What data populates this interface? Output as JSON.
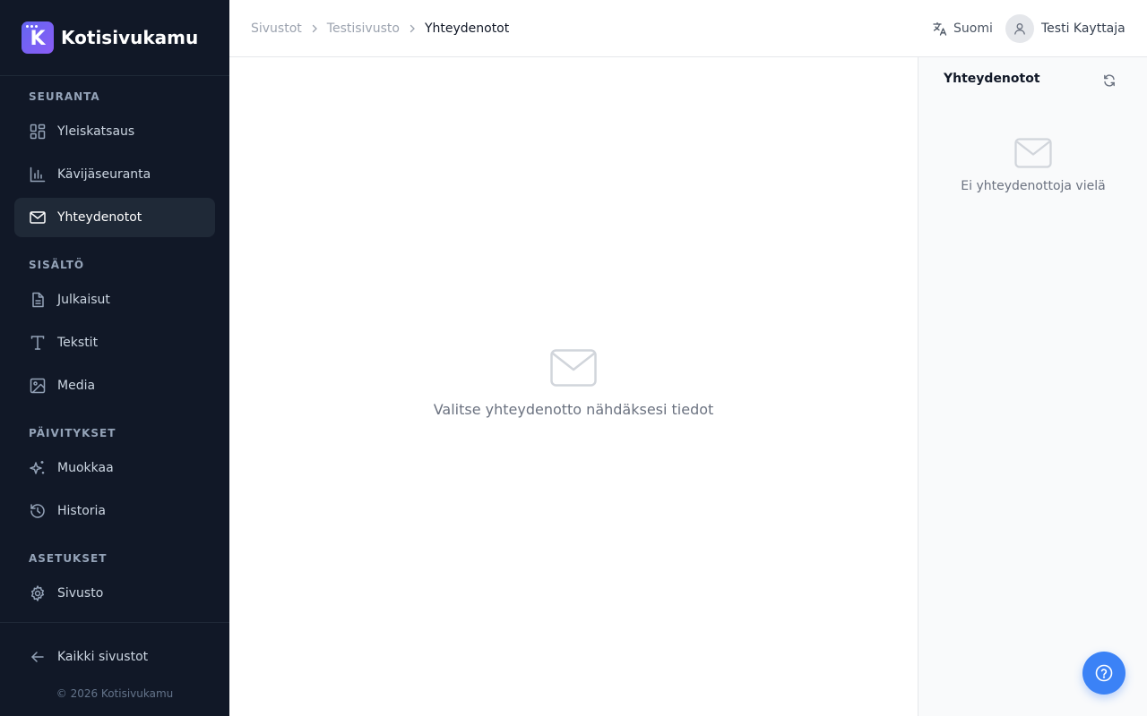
{
  "brand": {
    "name": "Kotisivukamu",
    "logo_letter": "K",
    "accent": "#6366f1"
  },
  "sidebar": {
    "sections": [
      {
        "title": "SEURANTA"
      },
      {
        "title": "SISÄLTÖ"
      },
      {
        "title": "PÄIVITYKSET"
      },
      {
        "title": "ASETUKSET"
      }
    ],
    "items": [
      {
        "label": "Yleiskatsaus",
        "icon": "grid-icon"
      },
      {
        "label": "Kävijäseuranta",
        "icon": "bar-chart-icon"
      },
      {
        "label": "Yhteydenotot",
        "icon": "mail-icon",
        "active": true
      },
      {
        "label": "Julkaisut",
        "icon": "document-icon"
      },
      {
        "label": "Tekstit",
        "icon": "text-icon"
      },
      {
        "label": "Media",
        "icon": "image-icon"
      },
      {
        "label": "Muokkaa",
        "icon": "sparkles-icon"
      },
      {
        "label": "Historia",
        "icon": "history-icon"
      },
      {
        "label": "Sivusto",
        "icon": "gear-icon"
      }
    ],
    "back_label": "Kaikki sivustot",
    "copyright": "© 2026 Kotisivukamu",
    "background": "#111827"
  },
  "header": {
    "breadcrumb": [
      "Sivustot",
      "Testisivusto",
      "Yhteydenotot"
    ],
    "language": "Suomi",
    "user_name": "Testi Kayttaja"
  },
  "main": {
    "empty_text": "Valitse yhteydenotto nähdäksesi tiedot"
  },
  "panel": {
    "title": "Yhteydenotot",
    "empty_text": "Ei yhteydenottoja vielä"
  },
  "help": {
    "icon": "help-icon",
    "color": "#3b82f6"
  }
}
